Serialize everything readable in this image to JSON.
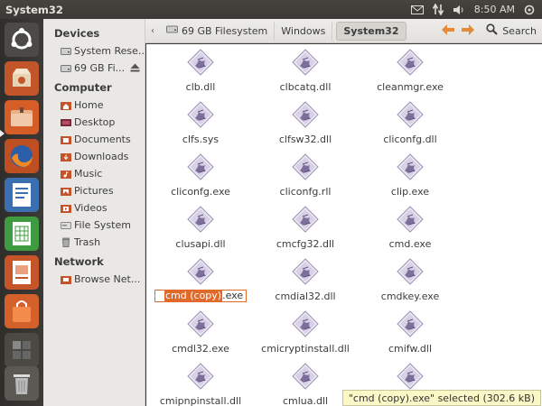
{
  "window": {
    "title": "System32"
  },
  "indicators": {
    "clock": "8:50 AM"
  },
  "sidebar": {
    "devices_heading": "Devices",
    "devices": [
      {
        "label": "System Rese...",
        "icon": "drive-icon"
      },
      {
        "label": "69 GB Fi...",
        "icon": "drive-icon"
      }
    ],
    "computer_heading": "Computer",
    "computer": [
      {
        "label": "Home",
        "icon": "home-folder-icon"
      },
      {
        "label": "Desktop",
        "icon": "desktop-icon"
      },
      {
        "label": "Documents",
        "icon": "documents-folder-icon"
      },
      {
        "label": "Downloads",
        "icon": "downloads-folder-icon"
      },
      {
        "label": "Music",
        "icon": "music-folder-icon"
      },
      {
        "label": "Pictures",
        "icon": "pictures-folder-icon"
      },
      {
        "label": "Videos",
        "icon": "videos-folder-icon"
      },
      {
        "label": "File System",
        "icon": "filesystem-icon"
      },
      {
        "label": "Trash",
        "icon": "trash-icon"
      }
    ],
    "network_heading": "Network",
    "network": [
      {
        "label": "Browse Net...",
        "icon": "network-icon"
      }
    ]
  },
  "toolbar": {
    "breadcrumbs": [
      "69 GB Filesystem",
      "Windows",
      "System32"
    ],
    "search_label": "Search"
  },
  "files": [
    {
      "name": "clb.dll"
    },
    {
      "name": "clbcatq.dll"
    },
    {
      "name": "cleanmgr.exe"
    },
    {
      "name": "clfs.sys"
    },
    {
      "name": "clfsw32.dll"
    },
    {
      "name": "cliconfg.dll"
    },
    {
      "name": "cliconfg.exe"
    },
    {
      "name": "cliconfg.rll"
    },
    {
      "name": "clip.exe"
    },
    {
      "name": "clusapi.dll"
    },
    {
      "name": "cmcfg32.dll"
    },
    {
      "name": "cmd.exe"
    },
    {
      "name": "cmd (copy).exe",
      "renaming": true,
      "sel_text": "cmd (copy)",
      "rest_text": ".exe"
    },
    {
      "name": "cmdial32.dll"
    },
    {
      "name": "cmdkey.exe"
    },
    {
      "name": "cmdl32.exe"
    },
    {
      "name": "cmicryptinstall.dll"
    },
    {
      "name": "cmifw.dll"
    },
    {
      "name": "cmipnpinstall.dll"
    },
    {
      "name": "cmlua.dll"
    },
    {
      "name": ""
    }
  ],
  "statusbar": {
    "text": "\"cmd (copy).exe\" selected (302.6 kB)"
  },
  "colors": {
    "accent": "#e06a2b",
    "panel": "#3c3b37",
    "sidebar": "#e9e8e5",
    "status_bg": "#fbf8c8"
  }
}
